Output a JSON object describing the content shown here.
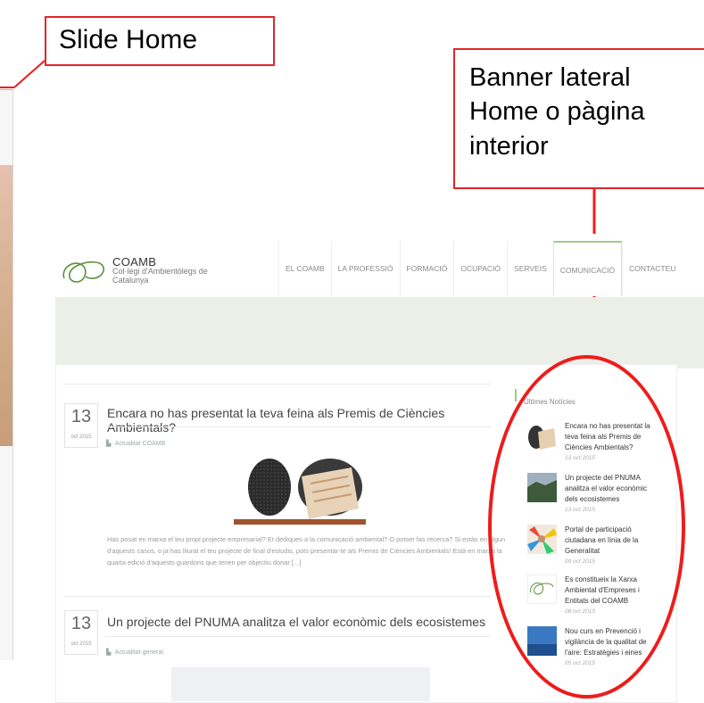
{
  "callouts": {
    "slide": "Slide Home",
    "banner": "Banner lateral Home o pàgina interior"
  },
  "site": {
    "name": "COAMB",
    "subtitle": "Col·legi d'Ambientòlegs de Catalunya",
    "nav": [
      "EL COAMB",
      "LA PROFESSIÓ",
      "FORMACIÓ",
      "OCUPACIÓ",
      "SERVEIS",
      "COMUNICACIÓ",
      "CONTACTEU"
    ],
    "active_nav": "COMUNICACIÓ"
  },
  "posts": [
    {
      "day": "13",
      "month": "oct 2015",
      "title": "Encara no has presentat la teva feina als Premis de Ciències Ambientals?",
      "category": "Actualitat COAMB",
      "excerpt": "Has posat en marxa el teu propi projecte empresarial? Et dediques a la comunicació ambiental? O potser fas recerca? Si estàs en algun d'aquests casos, o ja has lliurat el teu projecte de final d'estudis, pots presentar-te als Premis de Ciències Ambientals! Està en marxa la quarta edició d'aquests guardons que tenen per objectiu donar [...]"
    },
    {
      "day": "13",
      "month": "oct 2015",
      "title": "Un projecte del PNUMA analitza el valor econòmic dels ecosistemes",
      "category": "Actualitat general"
    }
  ],
  "sidebar": {
    "title": "Últimes Notícies",
    "items": [
      {
        "title": "Encara no has presentat la teva feina als Premis de Ciències Ambientals?",
        "date": "13 oct 2015"
      },
      {
        "title": "Un projecte del PNUMA analitza el valor econòmic dels ecosistemes",
        "date": "13 oct 2015"
      },
      {
        "title": "Portal de participació ciutadana en línia de la Generalitat",
        "date": "09 oct 2015"
      },
      {
        "title": "Es constitueix la Xarxa Ambiental d'Empreses i Entitats del COAMB",
        "date": "08 oct 2015"
      },
      {
        "title": "Nou curs en Prevenció i vigilància de la qualitat de l'aire: Estratègies i eines",
        "date": "05 oct 2015"
      }
    ]
  },
  "colors": {
    "callout_border": "#e0262b",
    "annotation": "#ee1c1c",
    "accent": "#a5c78a",
    "band": "#eceee8"
  },
  "icons": {
    "category": "tag-icon"
  }
}
